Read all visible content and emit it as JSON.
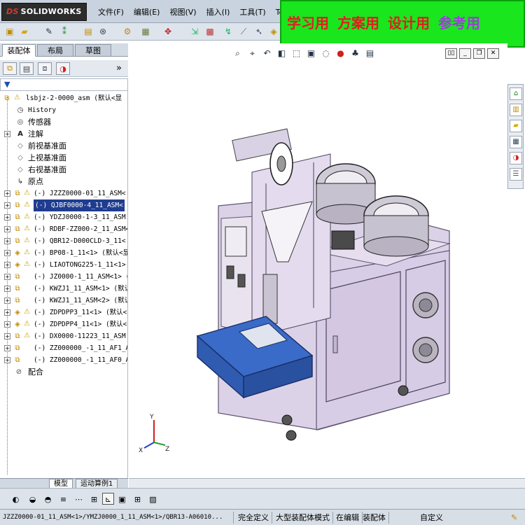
{
  "app": {
    "logo_text": "SOLIDWORKS",
    "logo_prefix": "DS"
  },
  "menu": [
    "文件(F)",
    "编辑(E)",
    "视图(V)",
    "插入(I)",
    "工具(T)",
    "Tool"
  ],
  "watermark": {
    "w1": "学习用",
    "w2": "方案用",
    "w3": "设计用",
    "w4": "参考用"
  },
  "pane_tabs": [
    "装配体",
    "布局",
    "草图"
  ],
  "tree": {
    "root": "lsbjz-2-0000_asm  (默认<显",
    "items": [
      "History",
      "传感器",
      "注解",
      "前视基准面",
      "上视基准面",
      "右视基准面",
      "原点",
      "(-) JZZZ0000-01_11_ASM<",
      "(-) QJBF0000-4_11_ASM<",
      "(-) YDZJ0000-1-3_11_ASM",
      "(-) RDBF-ZZ000-2_11_ASM<1",
      "(-) QBR12-D000CLD-3_11<",
      "(-) BP08-1_11<1> (默认<显",
      "(-) LIAOTONG225-1_11<1>",
      "(-) JZ0000-1_11_ASM<1> (默",
      "(-) KWZJ1_11_ASM<1> (默认",
      "(-) KWZJ1_11_ASM<2> (默认",
      "(-) ZDPDPP3_11<1> (默认<",
      "(-) ZDPDPP4_11<1> (默认<",
      "(-) DX0000-11223_11_ASM",
      "(-) ZZ000000_-1_11_AF1_ASM",
      "(-) ZZ000000_-1_11_AF0_ASM",
      "配合"
    ]
  },
  "bottom_tabs": [
    "模型",
    "运动算例1"
  ],
  "status": {
    "path": "JZZZ0000-01_11_ASM<1>/YMZJ0000_1_11_ASM<1>/QBR13-A06010...",
    "fully_defined": "完全定义",
    "large_assembly": "大型装配体模式",
    "editing": "在编辑",
    "assembly": "装配体",
    "custom": "自定义"
  },
  "axis": {
    "x": "X",
    "y": "Y",
    "z": "Z"
  },
  "colors": {
    "frame": "#dcd2e8",
    "frame_edge": "#8a7ca0",
    "tray": "#3a6bc8",
    "banner": "#19e61d",
    "selection": "#1f3c8f"
  }
}
